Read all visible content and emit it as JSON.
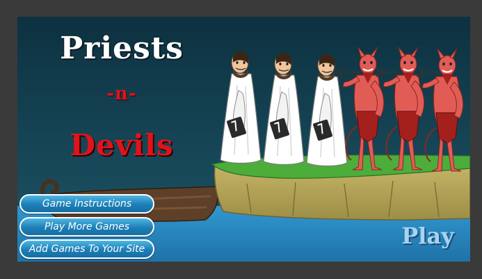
{
  "title": {
    "line1": "Priests",
    "line2": "-n-",
    "line3": "Devils"
  },
  "menu": {
    "instructions": "Game Instructions",
    "more_games": "Play More Games",
    "add_games": "Add Games To Your Site"
  },
  "play_label": "Play",
  "characters": {
    "priests": 3,
    "devils": 3
  },
  "icons": [
    "boat-icon",
    "priest-icon",
    "devil-icon",
    "trident-icon",
    "bible-icon",
    "island-icon"
  ],
  "colors": {
    "sky": "#164657",
    "water": "#2a8ec7",
    "grass": "#4cad3a",
    "cliff": "#bfae63",
    "boat": "#5e3f27",
    "priest_robe": "#ffffff",
    "devil": "#e25c56",
    "title_red": "#e0131c",
    "button_blue": "#1d7fb6"
  }
}
